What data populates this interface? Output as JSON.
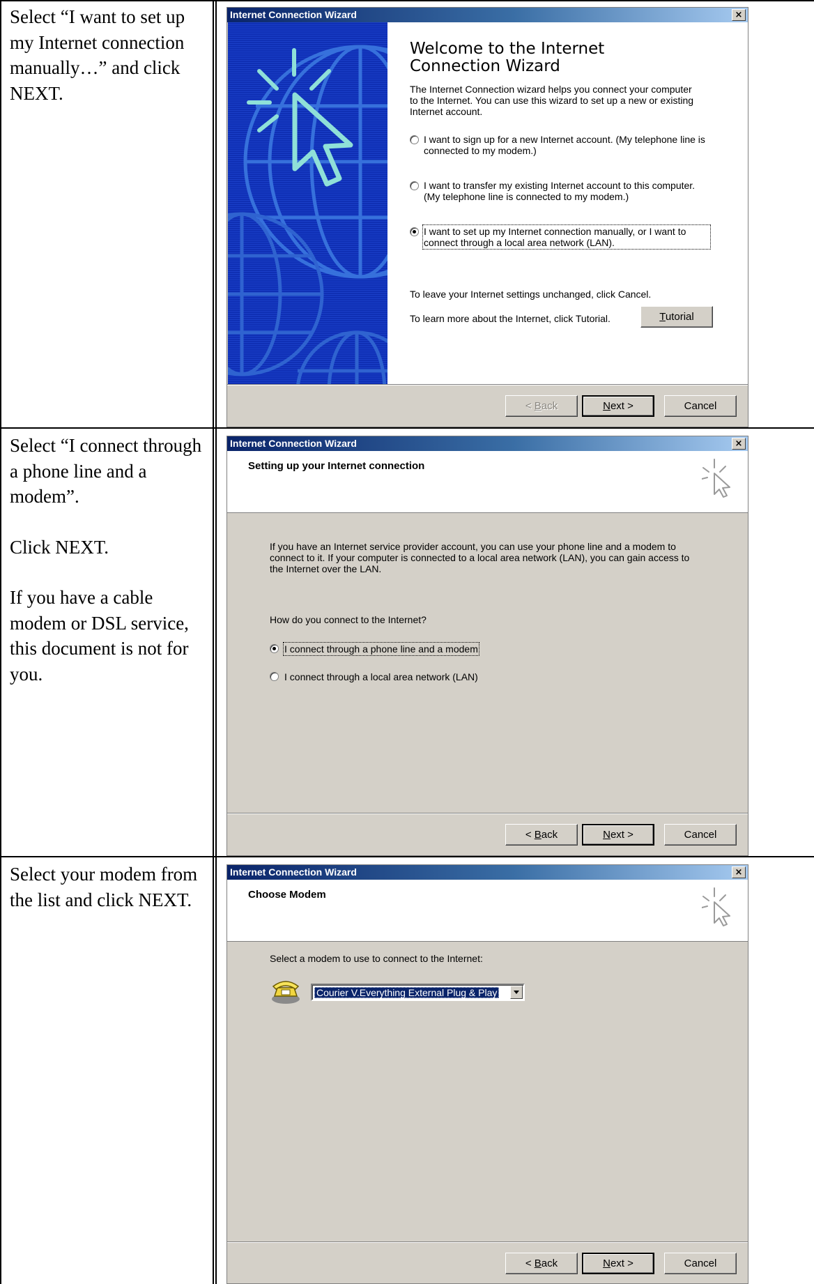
{
  "instructions": {
    "row1": [
      "Select “I want to set up my Internet connection manually…” and click NEXT."
    ],
    "row2": [
      "Select “I connect through a phone line and a modem”.",
      "Click NEXT.",
      "If you have a cable modem or DSL service, this document is not for you."
    ],
    "row3": [
      "Select your modem from the list and click NEXT."
    ]
  },
  "dialog_title": "Internet Connection Wizard",
  "close_glyph": "×",
  "buttons": {
    "back_underlined": "B",
    "back_rest": "ack",
    "back_prefix": "< ",
    "next_underlined": "N",
    "next_rest": "ext >",
    "cancel": "Cancel",
    "tutorial_underlined": "T",
    "tutorial_rest": "utorial"
  },
  "wizard1": {
    "title": "Welcome to the Internet Connection Wizard",
    "intro": "The Internet Connection wizard helps you connect your computer to the Internet.  You can use this wizard to set up a new or existing Internet account.",
    "options": [
      {
        "label": "I want to sign up for a new Internet account. (My telephone line is connected to my modem.)",
        "checked": false
      },
      {
        "label": "I want to transfer my existing Internet account to this computer. (My telephone line is connected to my modem.)",
        "checked": false
      },
      {
        "label": "I want to set up my Internet connection manually, or I want to connect through a local area network (LAN).",
        "checked": true
      }
    ],
    "leave_text": "To leave your Internet settings unchanged, click Cancel.",
    "learn_text": "To learn more about the Internet, click Tutorial.",
    "back_enabled": false
  },
  "wizard2": {
    "header": "Setting up your Internet connection",
    "body": "If you have an Internet service provider account, you can use your phone line and a modem to connect to it. If your computer is connected to a local area network (LAN), you can gain access to the Internet over the LAN.",
    "question": "How do you connect to the Internet?",
    "options": [
      {
        "label": "I connect through a phone line and a modem",
        "checked": true
      },
      {
        "label": "I connect through a local area network (LAN)",
        "checked": false
      }
    ]
  },
  "wizard3": {
    "header": "Choose Modem",
    "prompt": "Select a modem to use to connect to the Internet:",
    "selected_modem": "Courier V.Everything External Plug & Play"
  },
  "colors": {
    "dialog_face": "#d4d0c8",
    "title_blue": "#0a246a",
    "side_panel_blue": "#0f2fb4"
  }
}
